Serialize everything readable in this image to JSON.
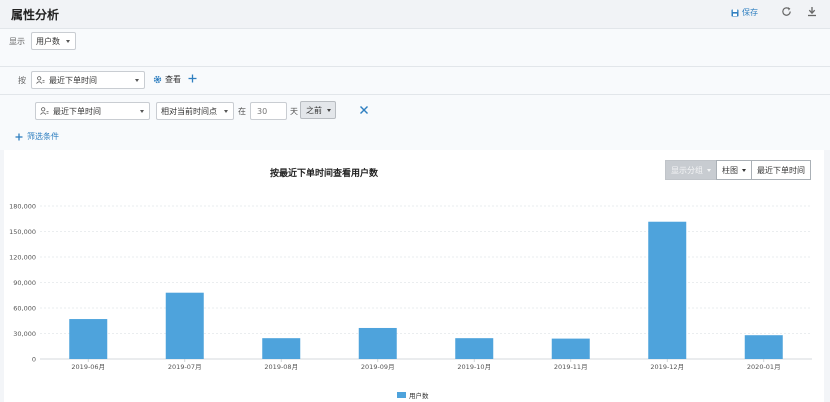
{
  "header": {
    "title": "属性分析",
    "save_label": "保存"
  },
  "display": {
    "label": "显示",
    "metric": "用户数"
  },
  "group_by": {
    "label": "按",
    "property": "最近下单时间",
    "view_label": "查看"
  },
  "filter": {
    "property": "最近下单时间",
    "relation": "相对当前时间点",
    "in_label": "在",
    "value_placeholder": "30",
    "unit": "天",
    "direction": "之前",
    "add_label": "筛选条件"
  },
  "toolbar": {
    "split_label": "显示分组",
    "chart_type": "柱图",
    "dimension": "最近下单时间"
  },
  "colors": {
    "bar": "#4ea3dc",
    "accent": "#2f7fc0"
  },
  "chart_data": {
    "type": "bar",
    "title": "按最近下单时间查看用户数",
    "categories": [
      "2019-06月",
      "2019-07月",
      "2019-08月",
      "2019-09月",
      "2019-10月",
      "2019-11月",
      "2019-12月",
      "2020-01月"
    ],
    "series": [
      {
        "name": "用户数",
        "values": [
          47000,
          78000,
          24500,
          36500,
          24500,
          24000,
          161500,
          28000
        ]
      }
    ],
    "ylim": [
      0,
      180000
    ],
    "yticks": [
      0,
      30000,
      60000,
      90000,
      120000,
      150000,
      180000
    ],
    "ytick_labels": [
      "0",
      "30,000",
      "60,000",
      "90,000",
      "120,000",
      "150,000",
      "180,000"
    ],
    "grid": true,
    "legend": "bottom-center"
  }
}
